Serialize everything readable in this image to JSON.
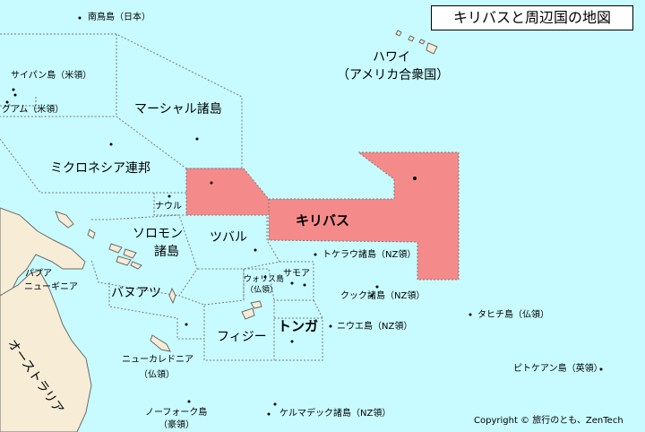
{
  "title": "キリバスと周辺国の地図",
  "copyright": "Copyright © 旅行のとも、ZenTech",
  "colors": {
    "ocean": "#c8fbff",
    "land": "#f7ecd6",
    "kiribati": "#f58a8a",
    "border": "#7a7a7a"
  },
  "labels": {
    "minamitori": "南鳥島（日本）",
    "saipan": "サイパン島（米領）",
    "guam": "グアム（米領）",
    "hawaii": "ハワイ",
    "hawaii_sub": "（アメリカ合衆国）",
    "marshall": "マーシャル諸島",
    "micronesia": "ミクロネシア連邦",
    "kiribati": "キリバス",
    "nauru": "ナウル",
    "solomon1": "ソロモン",
    "solomon2": "諸島",
    "tuvalu": "ツバル",
    "tokelau": "トケラウ諸島（NZ領）",
    "samoa": "サモア",
    "wallis1": "ウォリス島",
    "wallis2": "（仏領）",
    "cook": "クック諸島（NZ領）",
    "tahiti": "タヒチ島（仏領）",
    "papua1": "パプア",
    "papua2": "ニューギニア",
    "vanuatu": "バヌアツ",
    "tonga": "トンガ",
    "niue": "ニウエ島（NZ領）",
    "fiji": "フィジー",
    "newcaledonia1": "ニューカレドニア",
    "newcaledonia2": "（仏領）",
    "pitcairn": "ピトケアン島（英領）",
    "australia": "オーストラリア",
    "norfolk1": "ノーフォーク島",
    "norfolk2": "（豪領）",
    "kermadec": "ケルマデック諸島（NZ領）"
  }
}
